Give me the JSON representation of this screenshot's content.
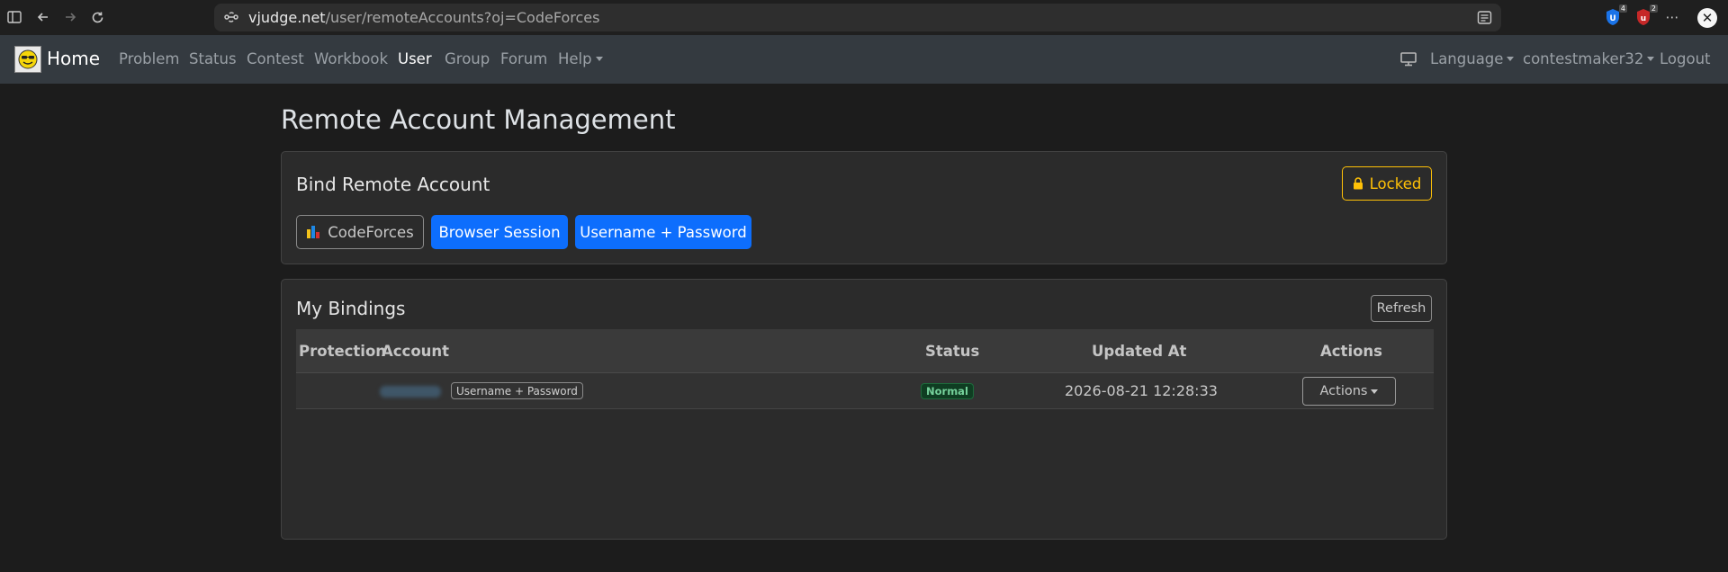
{
  "browser": {
    "url_host": "vjudge.net",
    "url_path": "/user/remoteAccounts?oj=CodeForces",
    "extensions": [
      {
        "name": "extension-1",
        "badge": "4",
        "color": "#1a73e8"
      },
      {
        "name": "extension-2",
        "badge": "2",
        "color": "#c62828"
      }
    ],
    "close_label": "✕"
  },
  "navbar": {
    "brand": "Home",
    "items": [
      {
        "label": "Problem",
        "active": false
      },
      {
        "label": "Status",
        "active": false
      },
      {
        "label": "Contest",
        "active": false
      },
      {
        "label": "Workbook",
        "active": false
      },
      {
        "label": "User",
        "active": true
      },
      {
        "label": "Group",
        "active": false
      },
      {
        "label": "Forum",
        "active": false
      },
      {
        "label": "Help",
        "active": false
      }
    ],
    "language": "Language",
    "username": "contestmaker32",
    "logout": "Logout"
  },
  "page": {
    "title": "Remote Account Management"
  },
  "bind_card": {
    "title": "Bind Remote Account",
    "locked_label": "Locked",
    "oj_button": "CodeForces",
    "session_button": "Browser Session",
    "userpass_button": "Username + Password"
  },
  "bindings_card": {
    "title": "My Bindings",
    "refresh_label": "Refresh",
    "columns": {
      "protection": "Protection",
      "account": "Account",
      "status": "Status",
      "updated_at": "Updated At",
      "actions": "Actions"
    },
    "rows": [
      {
        "type": "Username + Password",
        "status": "Normal",
        "updated_at": "2026-08-21 12:28:33",
        "actions_label": "Actions"
      }
    ]
  },
  "colors": {
    "primary": "#0d6efd",
    "warning": "#ffc107",
    "success": "#75d19b",
    "navbar": "#343a40"
  }
}
